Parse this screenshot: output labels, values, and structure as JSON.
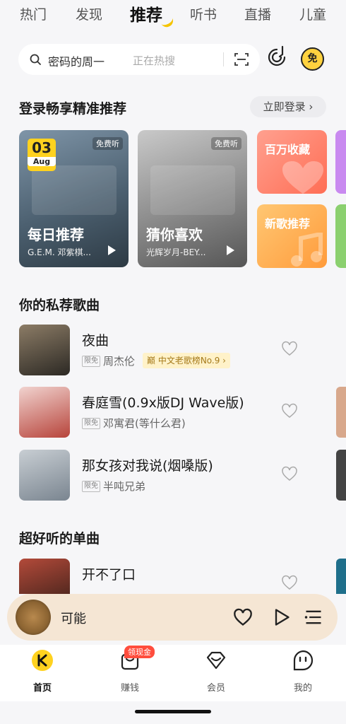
{
  "top_tabs": [
    "热门",
    "发现",
    "推荐",
    "听书",
    "直播",
    "儿童"
  ],
  "search": {
    "hot_query": "密码的周一",
    "status": "正在热搜"
  },
  "header_free": "免",
  "login_section": {
    "title": "登录畅享精准推荐",
    "button": "立即登录 ›"
  },
  "cards": [
    {
      "badge": "免费听",
      "date_day": "03",
      "date_month": "Aug",
      "title": "每日推荐",
      "subtitle": "G.E.M. 邓紫棋..."
    },
    {
      "badge": "免费听",
      "title": "猜你喜欢",
      "subtitle": "光辉岁月-BEY..."
    }
  ],
  "tiles": [
    "百万收藏",
    "新歌推荐"
  ],
  "private_section": {
    "title": "你的私荐歌曲"
  },
  "private_songs": [
    {
      "title": "夜曲",
      "tag": "限免",
      "artist": "周杰伦",
      "chart": "巅 中文老歌榜No.9 ›"
    },
    {
      "title": "春庭雪(0.9x版DJ Wave版)",
      "tag": "限免",
      "artist": "邓寓君(等什么君)"
    },
    {
      "title": "那女孩对我说(烟嗓版)",
      "tag": "限免",
      "artist": "半吨兄弟"
    }
  ],
  "singles_section": {
    "title": "超好听的单曲"
  },
  "singles": [
    {
      "title": "开不了口"
    }
  ],
  "player": {
    "title": "可能"
  },
  "cash_badge": "领现金",
  "nav": [
    "首页",
    "赚钱",
    "会员",
    "我的"
  ],
  "colors": {
    "accent": "#ffd21f",
    "tile_red": "#ff6e55",
    "tile_orange": "#ff9b3b",
    "badge_red": "#ff4d3d"
  }
}
